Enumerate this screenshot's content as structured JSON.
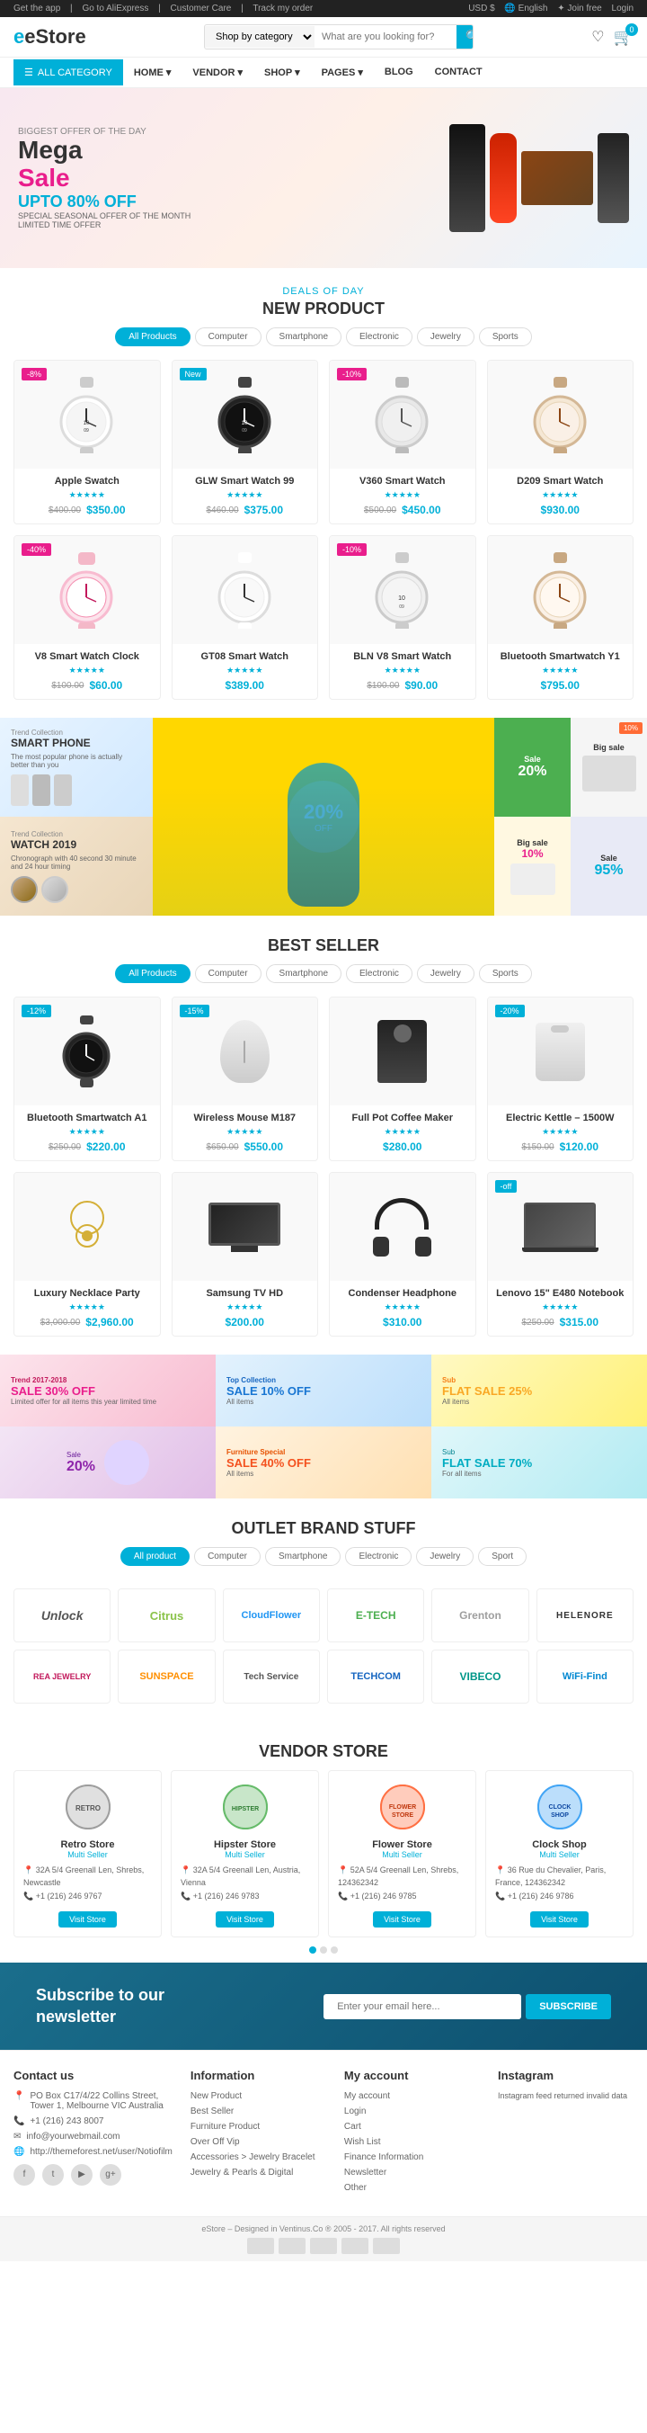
{
  "topbar": {
    "left": [
      "Get the app",
      "Go to AliExpress",
      "Customer Care",
      "Track my order"
    ],
    "right": [
      "USD $",
      "English",
      "Join free",
      "Login"
    ]
  },
  "header": {
    "logo": "eStore",
    "search": {
      "placeholder": "What are you looking for?",
      "category": "Shop by category"
    },
    "cart_count": "0"
  },
  "nav": {
    "all_category": "ALL CATEGORY",
    "links": [
      "HOME",
      "VENDOR",
      "SHOP",
      "PAGES",
      "BLOG",
      "CONTACT"
    ]
  },
  "hero": {
    "offer_label": "BIGGEST OFFER OF THE DAY",
    "title_line1": "Mega",
    "title_line2": "Sale",
    "discount": "UPTO 80% OFF",
    "special": "SPECIAL SEASONAL OFFER OF THE MONTH",
    "limited": "LIMITED TIME OFFER"
  },
  "deals": {
    "subtitle": "DEALS OF DAY",
    "title": "NEW PRODUCT",
    "tabs": [
      "All Products",
      "Computer",
      "Smartphone",
      "Electronic",
      "Jewelry",
      "Sports"
    ],
    "products": [
      {
        "name": "Apple Swatch",
        "old_price": "$400.00",
        "new_price": "$350.00",
        "badge": "-8%",
        "badge_color": "pink",
        "rating": "★★★★★"
      },
      {
        "name": "GLW Smart Watch 99",
        "old_price": "$460.00",
        "new_price": "$375.00",
        "badge": "New",
        "badge_color": "blue",
        "rating": "★★★★★"
      },
      {
        "name": "V360 Smart Watch",
        "old_price": "$500.00",
        "new_price": "$450.00",
        "badge": "-10%",
        "badge_color": "pink",
        "rating": "★★★★★"
      },
      {
        "name": "D209 Smart Watch",
        "new_price": "$930.00",
        "badge": "",
        "rating": "★★★★★"
      },
      {
        "name": "V8 Smart Watch Clock",
        "old_price": "$100.00",
        "new_price": "$60.00",
        "badge": "-40%",
        "badge_color": "pink",
        "rating": "★★★★★"
      },
      {
        "name": "GT08 Smart Watch",
        "new_price": "$389.00",
        "badge": "",
        "rating": "★★★★★"
      },
      {
        "name": "BLN V8 Smart Watch",
        "old_price": "$100.00",
        "new_price": "$90.00",
        "badge": "-10%",
        "badge_color": "pink",
        "rating": "★★★★★"
      },
      {
        "name": "Bluetooth Smartwatch Y1",
        "new_price": "$795.00",
        "badge": "",
        "rating": "★★★★★"
      }
    ]
  },
  "banners_mid": {
    "left_top": {
      "label": "Trend Collection",
      "title": "SMART PHONE",
      "sub": "The most popular phone is actually better than you"
    },
    "left_bottom": {
      "label": "Trend Collection",
      "title": "WATCH 2019",
      "sub": "Chronograph with 40 second 30 minute and 24 hour timing"
    },
    "center": {
      "discount": "20%",
      "label": "OFF"
    },
    "right_top_1": {
      "label": "Sale",
      "percent": "20%"
    },
    "right_top_2": {
      "label": "Big sale",
      "percent": "10%"
    },
    "right_bot_1": {
      "label": "Big sale",
      "percent": "10%"
    },
    "right_bot_2": {
      "label": "Sale",
      "percent": "95%"
    }
  },
  "bestseller": {
    "title": "BEST SELLER",
    "tabs": [
      "All Products",
      "Computer",
      "Smartphone",
      "Electronic",
      "Jewelry",
      "Sports"
    ],
    "products": [
      {
        "name": "Bluetooth Smartwatch A1",
        "old_price": "$250.00",
        "new_price": "$220.00",
        "badge": "-12%",
        "badge_color": "blue",
        "rating": "★★★★★"
      },
      {
        "name": "Wireless Mouse M187",
        "old_price": "$650.00",
        "new_price": "$550.00",
        "badge": "-15%",
        "badge_color": "blue",
        "rating": "★★★★★"
      },
      {
        "name": "Full Pot Coffee Maker",
        "new_price": "$280.00",
        "badge": "",
        "rating": "★★★★★"
      },
      {
        "name": "Electric Kettle – 1500W",
        "old_price": "$150.00",
        "new_price": "$120.00",
        "badge": "-20%",
        "badge_color": "blue",
        "rating": "★★★★★"
      },
      {
        "name": "Luxury Necklace Party",
        "old_price": "$3,000.00",
        "new_price": "$2,960.00",
        "badge": "",
        "rating": "★★★★★"
      },
      {
        "name": "Samsung TV HD",
        "new_price": "$200.00",
        "badge": "",
        "rating": "★★★★★"
      },
      {
        "name": "Condenser Headphone",
        "new_price": "$310.00",
        "badge": "",
        "rating": "★★★★★"
      },
      {
        "name": "Lenovo 15\" E480 Notebook",
        "old_price": "$250.00",
        "new_price": "$315.00",
        "badge": "-off",
        "badge_color": "blue",
        "rating": "★★★★★"
      }
    ]
  },
  "promo_banners": {
    "items": [
      {
        "label": "Trend 2017-2018",
        "sale": "SALE 30% OFF",
        "sub": "Limited offer for all items this year limited time"
      },
      {
        "label": "Top Collection",
        "sale": "SALE 10% OFF",
        "sub": "All items"
      },
      {
        "label": "Furniture Special",
        "sale": "SALE 40% OFF",
        "sub": "All items"
      },
      {
        "label": "Sub",
        "sale": "FLAT SALE 25%",
        "sub": "All items"
      },
      {
        "label": "",
        "sale": "Sale",
        "sub": "20%"
      },
      {
        "label": "",
        "sale": "FLAT SALE 70%",
        "sub": "For all items"
      }
    ]
  },
  "outlet": {
    "subtitle": "OUTLET BRAND STUFF",
    "tabs": [
      "All product",
      "Computer",
      "Smartphone",
      "Electronic",
      "Jewelry",
      "Sport"
    ],
    "brands_row1": [
      {
        "name": "Unlock",
        "style": "unlock"
      },
      {
        "name": "Citrus",
        "style": "citrus"
      },
      {
        "name": "CloudFlower",
        "style": "cloud"
      },
      {
        "name": "E-TECH",
        "style": "etech"
      },
      {
        "name": "Grenton",
        "style": "grenton"
      },
      {
        "name": "HELENORE",
        "style": "helenore"
      }
    ],
    "brands_row2": [
      {
        "name": "REA JEWELRY",
        "style": "rea"
      },
      {
        "name": "SUNSPACE",
        "style": "sun"
      },
      {
        "name": "Tech Service",
        "style": "techserv"
      },
      {
        "name": "TECHCOM",
        "style": "techcom"
      },
      {
        "name": "VIBECO",
        "style": "vibeco"
      },
      {
        "name": "WiFi-Find",
        "style": "wifi"
      }
    ]
  },
  "vendor": {
    "title": "VENDOR STORE",
    "stores": [
      {
        "name": "Retro Store",
        "type": "Multi Seller",
        "address": "32A 5/4 Greenall Len, Shrebs, Newcastle",
        "phone": "+1 (216) 246 9767",
        "color": "#9e9e9e"
      },
      {
        "name": "Hipster Store",
        "type": "Multi Seller",
        "address": "32A 5/4 Greenall Len, Austria, Vienna",
        "phone": "+1 (216) 246 9783",
        "color": "#66bb6a"
      },
      {
        "name": "Flower Store",
        "type": "Multi Seller",
        "address": "52A 5/4 Greenall Len, Shrebs, 124362342",
        "phone": "+1 (216) 246 9785",
        "color": "#ff7043"
      },
      {
        "name": "Clock Shop",
        "type": "Multi Seller",
        "address": "36 Rue du Chevalier, Paris, France, 124362342",
        "phone": "+1 (216) 246 9786",
        "color": "#42a5f5"
      }
    ],
    "visit_btn": "Visit Store"
  },
  "newsletter": {
    "title": "Subscribe to our\nnewsletter",
    "placeholder": "Enter your email here...",
    "button": "SUBSCRIBE"
  },
  "footer": {
    "contact": {
      "title": "Contact us",
      "address": "PO Box C17/4/22 Collins Street, Tower 1, Melbourne VIC Australia",
      "email": "info@yourwebmail.com",
      "website": "http://themeforest.net/user/Notiofilm",
      "phone": "+1 (216) 243 8007"
    },
    "information": {
      "title": "Information",
      "links": [
        "New Product",
        "Best Seller",
        "Furniture Product",
        "Over Off Vip",
        "Accessories > Jewelry Bracelet",
        "Jewelry & Pearls & Digital"
      ]
    },
    "account": {
      "title": "My account",
      "links": [
        "My account",
        "Login",
        "Cart",
        "Wish List",
        "Finance Information",
        "Newsletter",
        "Other"
      ]
    },
    "instagram": {
      "title": "Instagram",
      "text": "Instagram feed returned invalid data"
    },
    "copyright": "eStore – Designed in Ventinus.Co ® 2005 - 2017. All rights reserved"
  }
}
